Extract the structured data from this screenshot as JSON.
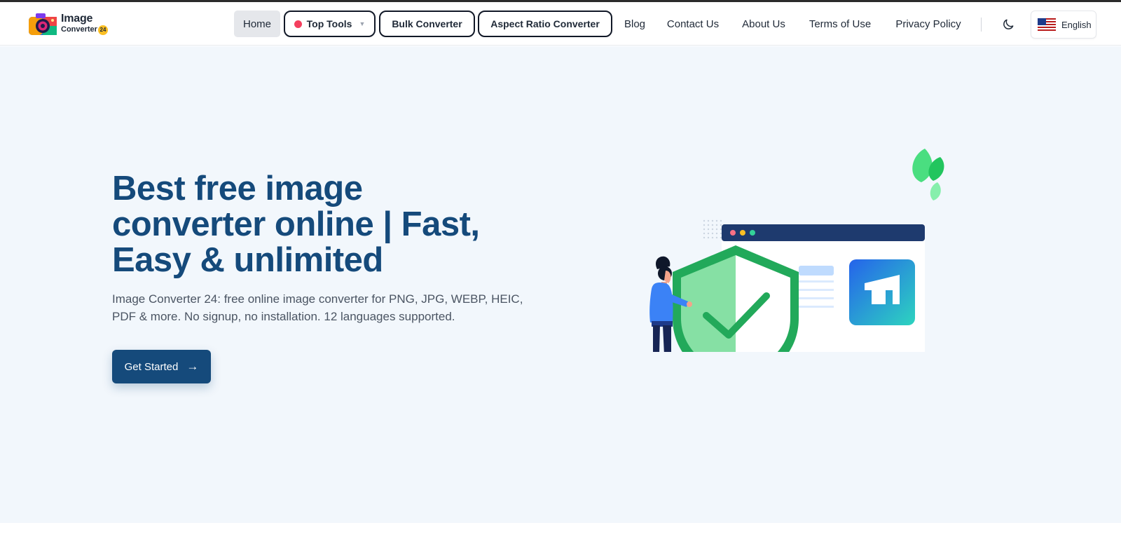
{
  "header": {
    "logo": {
      "line1": "Image",
      "line2": "Converter",
      "badge": "24"
    },
    "nav": {
      "home": "Home",
      "top_tools": "Top Tools",
      "bulk_converter": "Bulk Converter",
      "aspect_ratio_converter": "Aspect Ratio Converter",
      "blog": "Blog",
      "contact_us": "Contact Us",
      "about_us": "About Us",
      "terms_of_use": "Terms of Use",
      "privacy_policy": "Privacy Policy"
    },
    "icons": {
      "dropdown": "caret-down-icon",
      "theme_toggle": "moon-icon",
      "flag": "us-flag-icon"
    },
    "language": "English"
  },
  "hero": {
    "title_line1": "Best free image",
    "title_line2": "converter online | Fast,",
    "title_line3": "Easy & unlimited",
    "subtitle_line1": "Image Converter 24: free online image converter for PNG, JPG, WEBP, HEIC,",
    "subtitle_line2": "PDF & more. No signup, no installation. 12 languages supported.",
    "cta": "Get Started",
    "cta_icon": "arrow-right-icon"
  },
  "colors": {
    "primary": "#154a7b",
    "hero_bg": "#f2f7fc",
    "top_tools_dot": "#f43f5e",
    "shield_green": "#22a95a"
  }
}
